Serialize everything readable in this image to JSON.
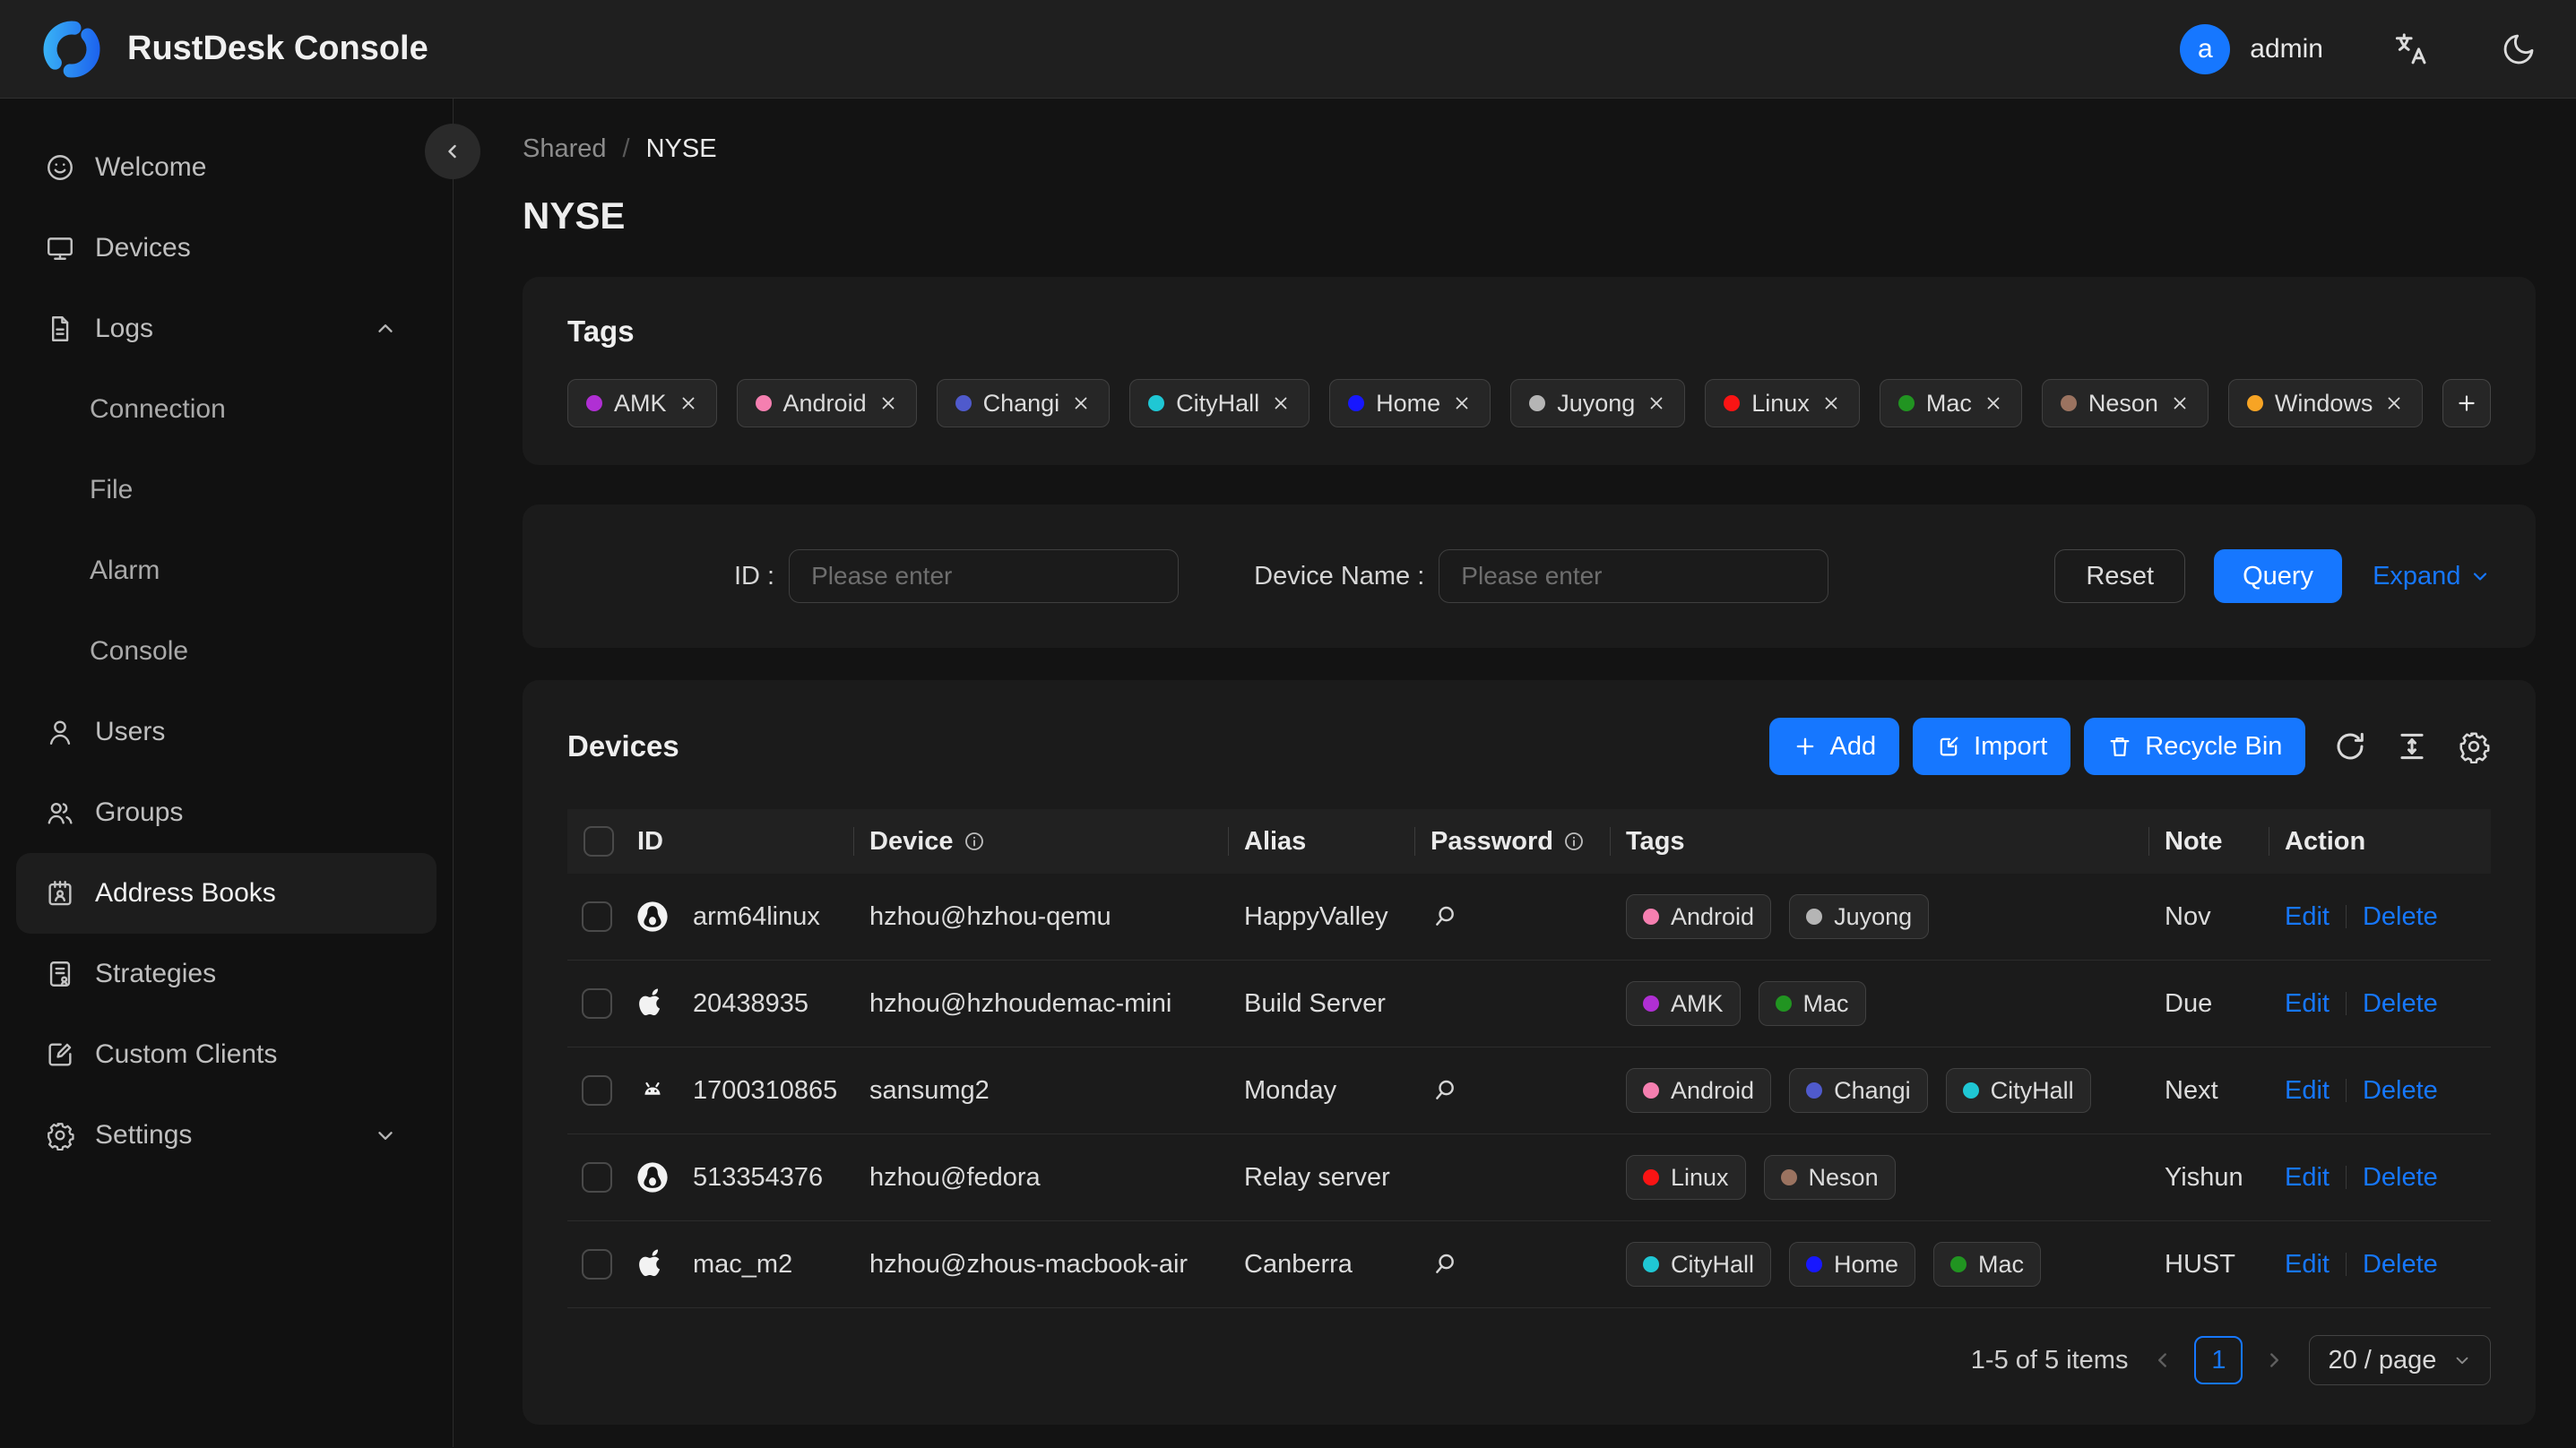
{
  "header": {
    "title": "RustDesk Console",
    "user": {
      "initial": "a",
      "name": "admin"
    }
  },
  "sidebar": {
    "items": [
      {
        "label": "Welcome"
      },
      {
        "label": "Devices"
      },
      {
        "label": "Logs",
        "expanded": true,
        "children": [
          "Connection",
          "File",
          "Alarm",
          "Console"
        ]
      },
      {
        "label": "Users"
      },
      {
        "label": "Groups"
      },
      {
        "label": "Address Books",
        "active": true
      },
      {
        "label": "Strategies"
      },
      {
        "label": "Custom Clients"
      },
      {
        "label": "Settings",
        "collapsed": true
      }
    ]
  },
  "breadcrumb": {
    "parent": "Shared",
    "separator": "/",
    "current": "NYSE"
  },
  "page_title": "NYSE",
  "tags_card": {
    "title": "Tags",
    "tags": [
      {
        "label": "AMK",
        "color": "#b02fd4"
      },
      {
        "label": "Android",
        "color": "#f57fb0"
      },
      {
        "label": "Changi",
        "color": "#4f5acc"
      },
      {
        "label": "CityHall",
        "color": "#1fc7d4"
      },
      {
        "label": "Home",
        "color": "#1717ff"
      },
      {
        "label": "Juyong",
        "color": "#b5b5b5"
      },
      {
        "label": "Linux",
        "color": "#fa1414"
      },
      {
        "label": "Mac",
        "color": "#219421"
      },
      {
        "label": "Neson",
        "color": "#9b7360"
      },
      {
        "label": "Windows",
        "color": "#f7a424"
      }
    ]
  },
  "filter": {
    "id_label": "ID :",
    "id_placeholder": "Please enter",
    "device_name_label": "Device Name :",
    "device_name_placeholder": "Please enter",
    "reset_label": "Reset",
    "query_label": "Query",
    "expand_label": "Expand"
  },
  "devices_card": {
    "title": "Devices",
    "buttons": {
      "add": "Add",
      "import": "Import",
      "recycle_bin": "Recycle Bin"
    },
    "table": {
      "columns": [
        {
          "label": "ID",
          "info": false
        },
        {
          "label": "Device",
          "info": true
        },
        {
          "label": "Alias",
          "info": false
        },
        {
          "label": "Password",
          "info": true
        },
        {
          "label": "Tags",
          "info": false
        },
        {
          "label": "Note",
          "info": false
        },
        {
          "label": "Action",
          "info": false
        }
      ],
      "rows": [
        {
          "os": "linux",
          "id": "arm64linux",
          "device": "hzhou@hzhou-qemu",
          "alias": "HappyValley",
          "has_password": true,
          "tags": [
            "Android",
            "Juyong"
          ],
          "note": "Nov"
        },
        {
          "os": "apple",
          "id": "20438935",
          "device": "hzhou@hzhoudemac-mini",
          "alias": "Build Server",
          "has_password": false,
          "tags": [
            "AMK",
            "Mac"
          ],
          "note": "Due"
        },
        {
          "os": "android",
          "id": "1700310865",
          "device": "sansumg2",
          "alias": "Monday",
          "has_password": true,
          "tags": [
            "Android",
            "Changi",
            "CityHall"
          ],
          "note": "Next"
        },
        {
          "os": "linux",
          "id": "513354376",
          "device": "hzhou@fedora",
          "alias": "Relay server",
          "has_password": false,
          "tags": [
            "Linux",
            "Neson"
          ],
          "note": "Yishun"
        },
        {
          "os": "apple",
          "id": "mac_m2",
          "device": "hzhou@zhous-macbook-air",
          "alias": "Canberra",
          "has_password": true,
          "tags": [
            "CityHall",
            "Home",
            "Mac"
          ],
          "note": "HUST"
        }
      ],
      "actions": [
        "Edit",
        "Delete"
      ]
    },
    "pagination": {
      "summary": "1-5 of 5 items",
      "current_page": "1",
      "page_size": "20 / page"
    }
  },
  "colors": {
    "accent": "#1677ff"
  }
}
